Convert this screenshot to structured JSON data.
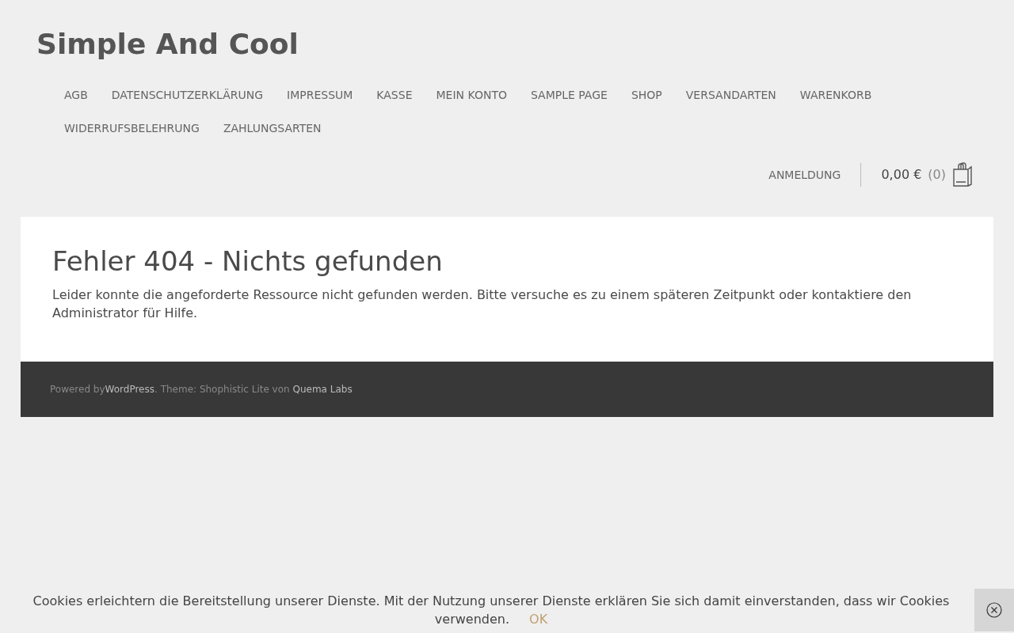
{
  "site_title": "Simple And Cool",
  "menu": [
    "AGB",
    "DATENSCHUTZERKLÄRUNG",
    "IMPRESSUM",
    "KASSE",
    "MEIN KONTO",
    "SAMPLE PAGE",
    "SHOP",
    "VERSANDARTEN",
    "WARENKORB",
    "WIDERRUFSBELEHRUNG",
    "ZAHLUNGSARTEN"
  ],
  "account": {
    "login": "ANMELDUNG",
    "cart_total": "0,00 €",
    "cart_count": "(0)"
  },
  "content": {
    "heading": "Fehler 404 - Nichts gefunden",
    "text": "Leider konnte die angeforderte Ressource nicht gefunden werden. Bitte versuche es zu einem späteren Zeitpunkt oder kontaktiere den Administrator für Hilfe."
  },
  "footer": {
    "prefix": "Powered by",
    "link_1": "WordPress",
    "middle": ". Theme: Shophistic Lite von ",
    "link_2": "Quema Labs"
  },
  "cookie_bar": {
    "text": "Cookies erleichtern die Bereitstellung unserer Dienste. Mit der Nutzung unserer Dienste erklären Sie sich damit einverstanden, dass wir Cookies verwenden.",
    "ok": "OK"
  }
}
